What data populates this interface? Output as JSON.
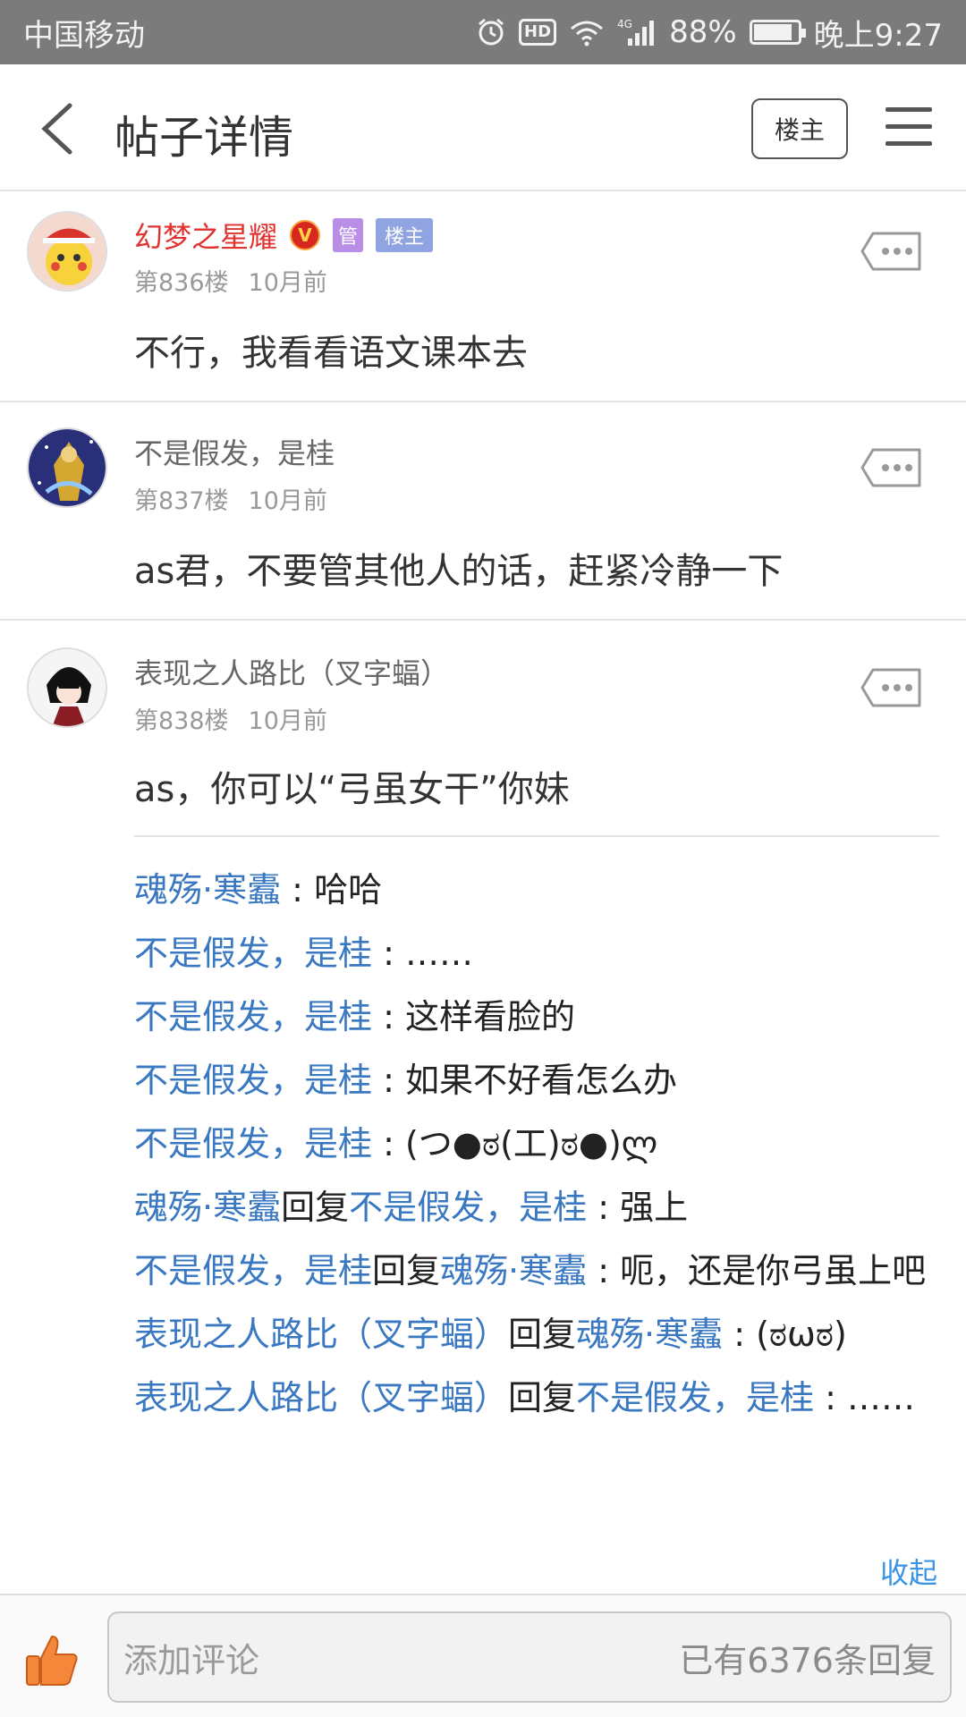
{
  "status": {
    "carrier": "中国移动",
    "battery": "88%",
    "time": "晚上9:27",
    "hd": "HD",
    "signal_label": "4G",
    "battery_level": 0.88
  },
  "header": {
    "title": "帖子详情",
    "op_button": "楼主"
  },
  "posts": [
    {
      "author": "幻梦之星耀",
      "badge_guan": "管",
      "badge_lz": "楼主",
      "v_badge": "V",
      "floor": "第836楼",
      "time": "10月前",
      "content": "不行，我看看语文课本去"
    },
    {
      "author": "不是假发，是桂",
      "floor": "第837楼",
      "time": "10月前",
      "content": "as君，不要管其他人的话，赶紧冷静一下"
    },
    {
      "author": "表现之人路比（叉字蝠）",
      "floor": "第838楼",
      "time": "10月前",
      "content": "as，你可以“弓虽女干”你妹"
    }
  ],
  "replies": [
    {
      "user": "魂殇·寒蠹",
      "to": "",
      "text": "哈哈"
    },
    {
      "user": "不是假发，是桂",
      "to": "",
      "text": "……"
    },
    {
      "user": "不是假发，是桂",
      "to": "",
      "text": "这样看脸的"
    },
    {
      "user": "不是假发，是桂",
      "to": "",
      "text": "如果不好看怎么办"
    },
    {
      "user": "不是假发，是桂",
      "to": "",
      "text": "(つ●ಠ(工)ಠ●)ლ"
    },
    {
      "user": "魂殇·寒蠹",
      "to": "不是假发，是桂",
      "text": "强上"
    },
    {
      "user": "不是假发，是桂",
      "to": "魂殇·寒蠹",
      "text": "呃，还是你弓虽上吧"
    },
    {
      "user": "表现之人路比（叉字蝠）",
      "to": "魂殇·寒蠹",
      "text": "(ಠωಠ)"
    },
    {
      "user": "表现之人路比（叉字蝠）",
      "to": "不是假发，是桂",
      "text": "……"
    }
  ],
  "reply_word": "回复",
  "reply_sep": " : ",
  "collapse_label": "收起",
  "bottom": {
    "placeholder": "添加评论",
    "reply_count": "已有6376条回复"
  },
  "colors": {
    "link_blue": "#3a78c2",
    "author_red": "#e0322f",
    "like_orange": "#f5873a"
  }
}
